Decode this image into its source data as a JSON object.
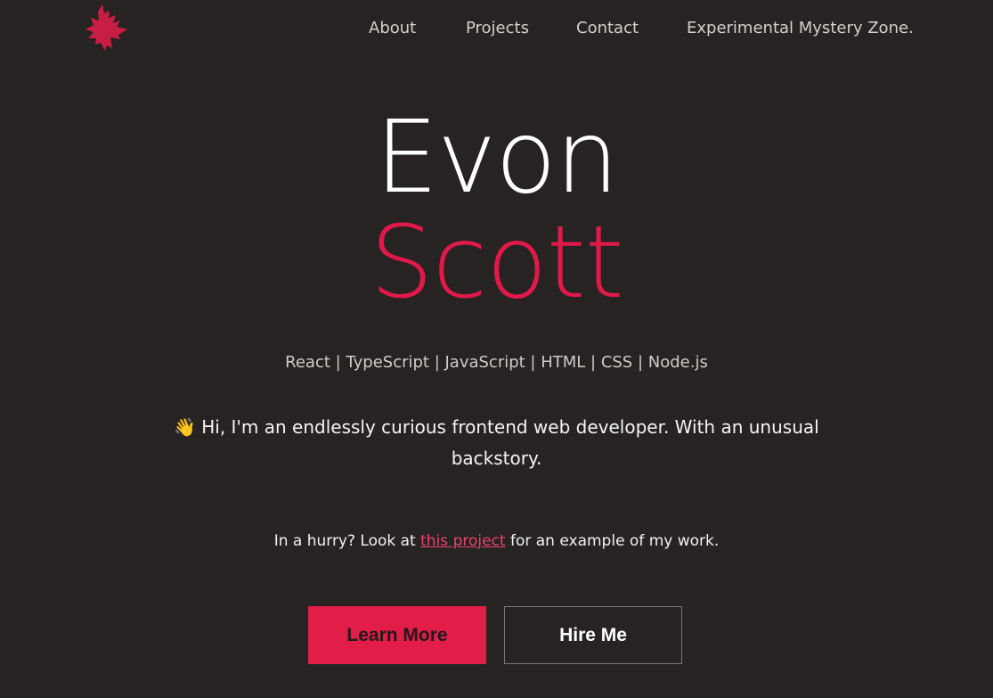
{
  "nav": {
    "items": [
      {
        "label": "About"
      },
      {
        "label": "Projects"
      },
      {
        "label": "Contact"
      },
      {
        "label": "Experimental Mystery Zone."
      }
    ]
  },
  "hero": {
    "first_name": "Evon",
    "last_name": "Scott"
  },
  "skills": "React | TypeScript | JavaScript | HTML | CSS | Node.js",
  "intro": {
    "emoji": "👋",
    "text": "Hi, I'm an endlessly curious frontend web developer. With an unusual backstory."
  },
  "hurry": {
    "prefix": "In a hurry? Look at ",
    "link_text": "this project",
    "suffix": " for an example of my work."
  },
  "buttons": {
    "primary_label": "Learn More",
    "secondary_label": "Hire Me"
  },
  "colors": {
    "background": "#272322",
    "accent": "#e11d48",
    "text": "#f2f2f2"
  },
  "icons": {
    "logo": "maple-leaf-icon"
  }
}
